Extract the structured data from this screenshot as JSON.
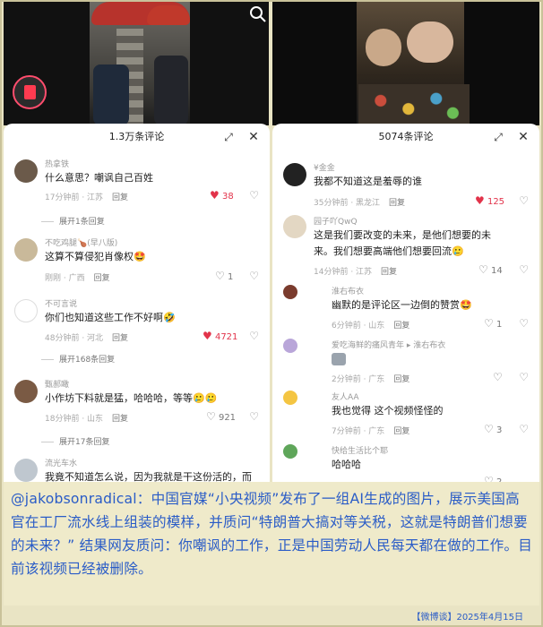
{
  "left_panel": {
    "title": "1.3万条评论",
    "comments": [
      {
        "user": "热拿铁",
        "text": "什么意思？嘲讽自己百姓",
        "time": "17分钟前 · 江苏",
        "reply": "回复",
        "likes": "38",
        "liked": true,
        "expand": "展开1条回复"
      },
      {
        "user": "不吃鸡腿🍗(早八版)",
        "text": "这算不算侵犯肖像权🤩",
        "time": "刚刚 · 广西",
        "reply": "回复",
        "likes": "1",
        "liked": false,
        "expand": ""
      },
      {
        "user": "不可言说",
        "text": "你们也知道这些工作不好啊🤣",
        "time": "48分钟前 · 河北",
        "reply": "回复",
        "likes": "4721",
        "liked": true,
        "expand": "展开168条回复"
      },
      {
        "user": "甄郝瞰",
        "text": "小作坊下料就是猛，哈哈哈，等等🥲🥲",
        "time": "18分钟前 · 山东",
        "reply": "回复",
        "likes": "921",
        "liked": false,
        "expand": "展开17条回复"
      },
      {
        "user": "流光车水",
        "text": "我竟不知道怎么说，因为我就是干这份活的，而",
        "time": "",
        "reply": "",
        "likes": "",
        "liked": false,
        "expand": ""
      }
    ]
  },
  "right_panel": {
    "title": "5074条评论",
    "comments": [
      {
        "user": "¥金金",
        "text": "我都不知道这是羞辱的谁",
        "text2": "",
        "time": "35分钟前 · 黑龙江",
        "reply": "回复",
        "likes": "125",
        "liked": true
      },
      {
        "user": "园子吖QwQ",
        "text": "这是我们要改变的未来，是他们想要的未",
        "text2": "来。我们想要高端他们想要回流🥲",
        "time": "14分钟前 · 江苏",
        "reply": "回复",
        "likes": "14",
        "liked": false
      },
      {
        "user": "淮右布衣",
        "text": "幽默的是评论区一边倒的赞赏🤩",
        "text2": "",
        "time": "6分钟前 · 山东",
        "reply": "回复",
        "likes": "1",
        "liked": false
      },
      {
        "user": "爱吃海鲜的痛风青年 ▸ 淮右布衣",
        "text": "",
        "text2": "",
        "time": "2分钟前 · 广东",
        "reply": "回复",
        "likes": "",
        "liked": false
      },
      {
        "user": "友人AA",
        "text": "我也觉得 这个视频怪怪的",
        "text2": "",
        "time": "7分钟前 · 广东",
        "reply": "回复",
        "likes": "3",
        "liked": false
      },
      {
        "user": "快给生活比个耶",
        "text": "哈哈哈",
        "text2": "",
        "time": "",
        "reply": "",
        "likes": "2",
        "liked": false
      }
    ]
  },
  "caption": "@jakobsonradical：中国官媒“小央视频”发布了一组AI生成的图片，展示美国高官在工厂流水线上组装的模样，并质问“特朗普大搞对等关税，这就是特朗普们想要的未来？” 结果网友质问：你嘲讽的工作，正是中国劳动人民每天都在做的工作。目前该视频已经被删除。",
  "footer": "【微博谈】2025年4月15日"
}
